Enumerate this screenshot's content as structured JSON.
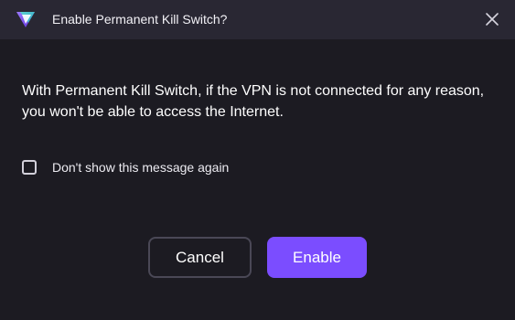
{
  "dialog": {
    "title": "Enable Permanent Kill Switch?",
    "message": "With Permanent Kill Switch, if the VPN is not connected for any reason, you won't be able to access the Internet.",
    "checkbox": {
      "label": "Don't show this message again",
      "checked": false
    },
    "buttons": {
      "cancel": "Cancel",
      "enable": "Enable"
    }
  },
  "icons": {
    "logo": "proton-vpn-logo-icon",
    "close": "close-icon"
  },
  "colors": {
    "background": "#1c1b22",
    "titlebar": "#292733",
    "accent": "#7b4dff",
    "cancel_border": "#4a4856"
  }
}
